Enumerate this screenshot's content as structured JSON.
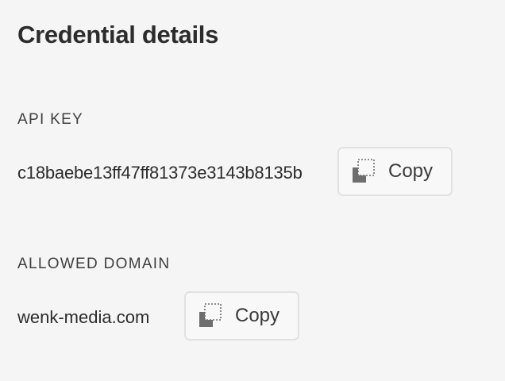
{
  "header": {
    "title": "Credential details"
  },
  "api_key": {
    "label": "API KEY",
    "value": "c18baebe13ff47ff81373e3143b8135b",
    "copy_label": "Copy",
    "copy_icon": "copy-icon"
  },
  "allowed_domain": {
    "label": "ALLOWED DOMAIN",
    "value": "wenk-media.com",
    "copy_label": "Copy",
    "copy_icon": "copy-icon"
  },
  "colors": {
    "background": "#f5f5f5",
    "text": "#2c2c2c",
    "button_border": "#e1e1e1",
    "icon": "#6e6e6e"
  }
}
